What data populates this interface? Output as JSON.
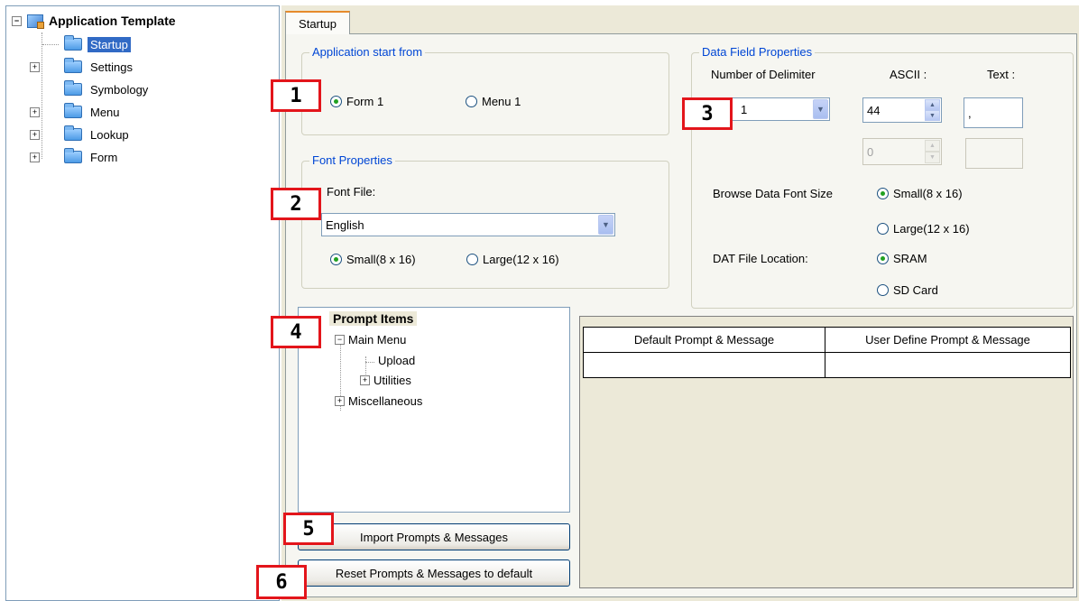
{
  "tree": {
    "root_label": "Application Template",
    "items": [
      {
        "label": "Startup",
        "expander": ""
      },
      {
        "label": "Settings",
        "expander": "+"
      },
      {
        "label": "Symbology",
        "expander": ""
      },
      {
        "label": "Menu",
        "expander": "+"
      },
      {
        "label": "Lookup",
        "expander": "+"
      },
      {
        "label": "Form",
        "expander": "+"
      }
    ]
  },
  "tab": {
    "label": "Startup"
  },
  "app_start": {
    "title": "Application start from",
    "option1": "Form 1",
    "option2": "Menu 1"
  },
  "font_props": {
    "title": "Font Properties",
    "font_file_label": "Font File:",
    "font_file_value": "English",
    "small": "Small(8 x 16)",
    "large": "Large(12 x 16)"
  },
  "data_field": {
    "title": "Data Field Properties",
    "num_delim_label": "Number of Delimiter",
    "ascii_label": "ASCII :",
    "text_label": "Text :",
    "num_delim_value": "1",
    "ascii1": "44",
    "text1": ",",
    "ascii2": "0",
    "browse_label": "Browse Data Font Size",
    "browse_small": "Small(8 x 16)",
    "browse_large": "Large(12 x 16)",
    "dat_label": "DAT File Location:",
    "dat_sram": "SRAM",
    "dat_sd": "SD Card"
  },
  "prompt_tree": {
    "title": "Prompt Items",
    "main_menu": "Main Menu",
    "upload": "Upload",
    "utilities": "Utilities",
    "misc": "Miscellaneous",
    "minus": "−",
    "plus": "+"
  },
  "table": {
    "col1": "Default Prompt & Message",
    "col2": "User Define Prompt & Message"
  },
  "buttons": {
    "import": "Import Prompts & Messages",
    "reset": "Reset Prompts & Messages to default"
  },
  "icons": {
    "combo_arrow": "▼",
    "spin_up": "▲",
    "spin_down": "▼",
    "root_expander": "−"
  },
  "callouts": [
    "1",
    "2",
    "3",
    "4",
    "5",
    "6"
  ],
  "colors": {
    "callout_border": "#e3151b",
    "group_title": "#0046d5",
    "selection": "#316ac5"
  }
}
